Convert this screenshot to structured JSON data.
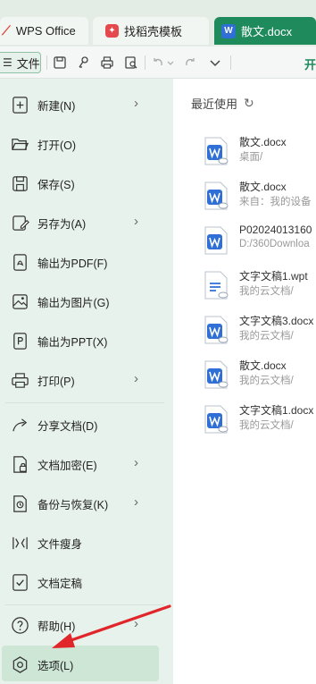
{
  "tabs": [
    {
      "label": "WPS Office",
      "icon": "wps-logo-icon"
    },
    {
      "label": "找稻壳模板",
      "icon": "docer-logo-icon"
    },
    {
      "label": "散文.docx",
      "icon": "word-doc-icon",
      "active": true
    }
  ],
  "toolbar": {
    "file_label": "文件",
    "right_label": "开"
  },
  "menu": {
    "items": [
      {
        "label": "新建(N)",
        "icon": "new-file-icon",
        "submenu": true
      },
      {
        "label": "打开(O)",
        "icon": "folder-open-icon",
        "submenu": false
      },
      {
        "label": "保存(S)",
        "icon": "save-icon",
        "submenu": false
      },
      {
        "label": "另存为(A)",
        "icon": "save-as-icon",
        "submenu": true
      },
      {
        "label": "输出为PDF(F)",
        "icon": "export-pdf-icon",
        "submenu": false
      },
      {
        "label": "输出为图片(G)",
        "icon": "export-image-icon",
        "submenu": false
      },
      {
        "label": "输出为PPT(X)",
        "icon": "export-ppt-icon",
        "submenu": false
      },
      {
        "label": "打印(P)",
        "icon": "print-icon",
        "submenu": true
      },
      {
        "label": "分享文档(D)",
        "icon": "share-icon",
        "submenu": false
      },
      {
        "label": "文档加密(E)",
        "icon": "encrypt-icon",
        "submenu": true
      },
      {
        "label": "备份与恢复(K)",
        "icon": "backup-icon",
        "submenu": true
      },
      {
        "label": "文件瘦身",
        "icon": "slim-icon",
        "submenu": false
      },
      {
        "label": "文档定稿",
        "icon": "finalize-icon",
        "submenu": false
      },
      {
        "label": "帮助(H)",
        "icon": "help-icon",
        "submenu": true
      },
      {
        "label": "选项(L)",
        "icon": "options-gear-icon",
        "submenu": false,
        "selected": true
      }
    ]
  },
  "recent": {
    "title": "最近使用",
    "refresh_icon": "refresh-icon",
    "files": [
      {
        "name": "散文.docx",
        "path": "桌面/",
        "type": "docx-cloud"
      },
      {
        "name": "散文.docx",
        "path": "来自：我的设备",
        "type": "docx-cloud"
      },
      {
        "name": "P02024013160",
        "path": "D:/360Downloa",
        "type": "docx"
      },
      {
        "name": "文字文稿1.wpt",
        "path": "我的云文档/",
        "type": "wpt-cloud"
      },
      {
        "name": "文字文稿3.docx",
        "path": "我的云文档/",
        "type": "docx-cloud"
      },
      {
        "name": "散文.docx",
        "path": "我的云文档/",
        "type": "docx-cloud"
      },
      {
        "name": "文字文稿1.docx",
        "path": "我的云文档/",
        "type": "docx-cloud"
      }
    ]
  },
  "colors": {
    "accent": "#1f8a5b",
    "menu_bg": "#e8f2ec",
    "selected_bg": "#cde6d6",
    "annotation_arrow": "#e0262a",
    "word_blue": "#2f6fd6"
  }
}
